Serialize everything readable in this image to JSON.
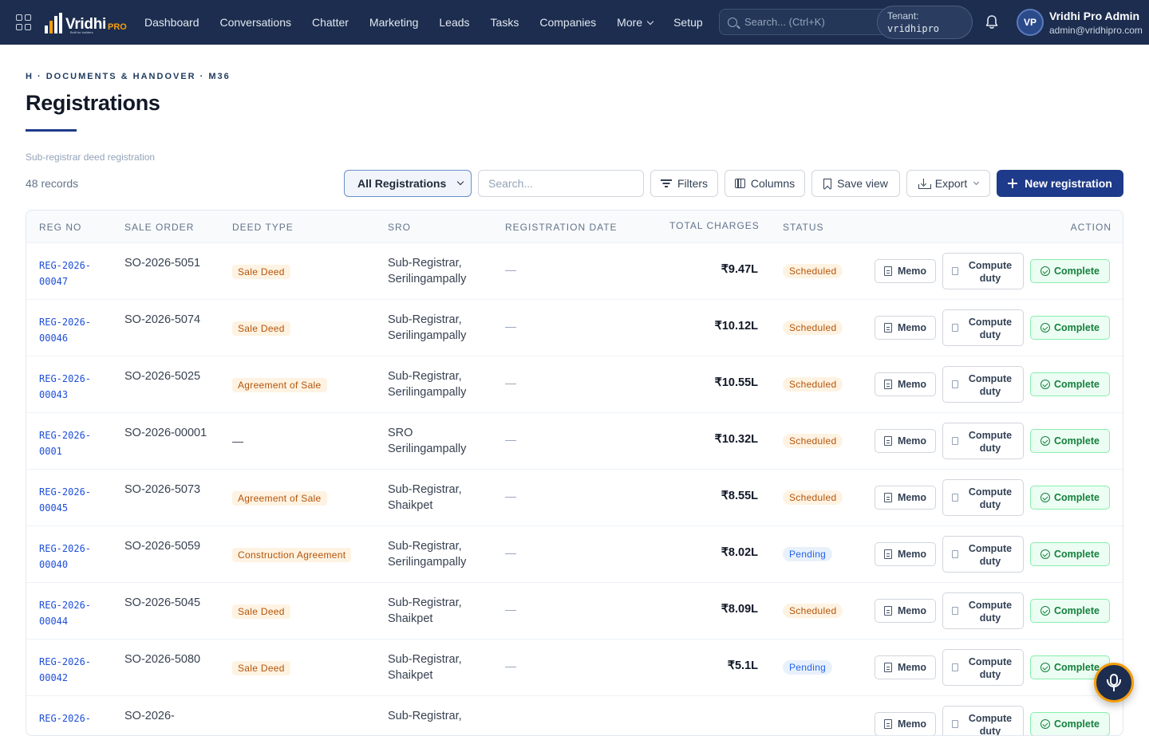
{
  "topnav": {
    "logo_text": "Vridhi",
    "logo_suffix": "PRO",
    "logo_tagline": "Built for builders",
    "items": [
      {
        "label": "Dashboard"
      },
      {
        "label": "Conversations"
      },
      {
        "label": "Chatter"
      },
      {
        "label": "Marketing"
      },
      {
        "label": "Leads"
      },
      {
        "label": "Tasks"
      },
      {
        "label": "Companies"
      },
      {
        "label": "More"
      },
      {
        "label": "Setup"
      }
    ],
    "search_placeholder": "Search... (Ctrl+K)",
    "tenant_label": "Tenant:",
    "tenant_value": "vridhipro",
    "avatar_initials": "VP",
    "user_name": "Vridhi Pro Admin",
    "user_email": "admin@vridhipro.com"
  },
  "page": {
    "breadcrumb": "H · DOCUMENTS & HANDOVER · M36",
    "title": "Registrations",
    "subtitle": "Sub-registrar deed registration",
    "records": "48 records"
  },
  "toolbar": {
    "view_select": "All Registrations",
    "search_placeholder": "Search...",
    "filters": "Filters",
    "columns": "Columns",
    "save_view": "Save view",
    "export": "Export",
    "new_registration": "New registration"
  },
  "table": {
    "headers": {
      "reg_no": "REG NO",
      "sale_order": "SALE ORDER",
      "deed_type": "DEED TYPE",
      "sro": "SRO",
      "registration_date": "REGISTRATION DATE",
      "total_charges": "TOTAL CHARGES",
      "status": "STATUS",
      "action": "ACTION"
    },
    "action_labels": {
      "memo": "Memo",
      "compute_duty": "Compute duty",
      "complete": "Complete"
    },
    "rows": [
      {
        "reg_no": "REG-2026-00047",
        "sale_order": "SO-2026-5051",
        "deed_type": "Sale Deed",
        "sro": "Sub-Registrar, Serilingampally",
        "date": "—",
        "total": "₹9.47L",
        "status": "Scheduled"
      },
      {
        "reg_no": "REG-2026-00046",
        "sale_order": "SO-2026-5074",
        "deed_type": "Sale Deed",
        "sro": "Sub-Registrar, Serilingampally",
        "date": "—",
        "total": "₹10.12L",
        "status": "Scheduled"
      },
      {
        "reg_no": "REG-2026-00043",
        "sale_order": "SO-2026-5025",
        "deed_type": "Agreement of Sale",
        "sro": "Sub-Registrar, Serilingampally",
        "date": "—",
        "total": "₹10.55L",
        "status": "Scheduled"
      },
      {
        "reg_no": "REG-2026-0001",
        "sale_order": "SO-2026-00001",
        "deed_type": "—",
        "sro": "SRO Serilingampally",
        "date": "—",
        "total": "₹10.32L",
        "status": "Scheduled"
      },
      {
        "reg_no": "REG-2026-00045",
        "sale_order": "SO-2026-5073",
        "deed_type": "Agreement of Sale",
        "sro": "Sub-Registrar, Shaikpet",
        "date": "—",
        "total": "₹8.55L",
        "status": "Scheduled"
      },
      {
        "reg_no": "REG-2026-00040",
        "sale_order": "SO-2026-5059",
        "deed_type": "Construction Agreement",
        "sro": "Sub-Registrar, Serilingampally",
        "date": "—",
        "total": "₹8.02L",
        "status": "Pending"
      },
      {
        "reg_no": "REG-2026-00044",
        "sale_order": "SO-2026-5045",
        "deed_type": "Sale Deed",
        "sro": "Sub-Registrar, Shaikpet",
        "date": "—",
        "total": "₹8.09L",
        "status": "Scheduled"
      },
      {
        "reg_no": "REG-2026-00042",
        "sale_order": "SO-2026-5080",
        "deed_type": "Sale Deed",
        "sro": "Sub-Registrar, Shaikpet",
        "date": "—",
        "total": "₹5.1L",
        "status": "Pending"
      },
      {
        "reg_no": "REG-2026-",
        "sale_order": "SO-2026-",
        "deed_type": "",
        "sro": "Sub-Registrar,",
        "date": "",
        "total": "",
        "status": ""
      }
    ]
  },
  "icons": {
    "apps": "grid-icon",
    "search": "search-icon",
    "bell": "bell-icon",
    "mic": "microphone-icon"
  },
  "colors": {
    "nav_bg": "#1c2d4f",
    "primary": "#1e3a8a",
    "accent": "#f59e0b",
    "success": "#15803d"
  }
}
